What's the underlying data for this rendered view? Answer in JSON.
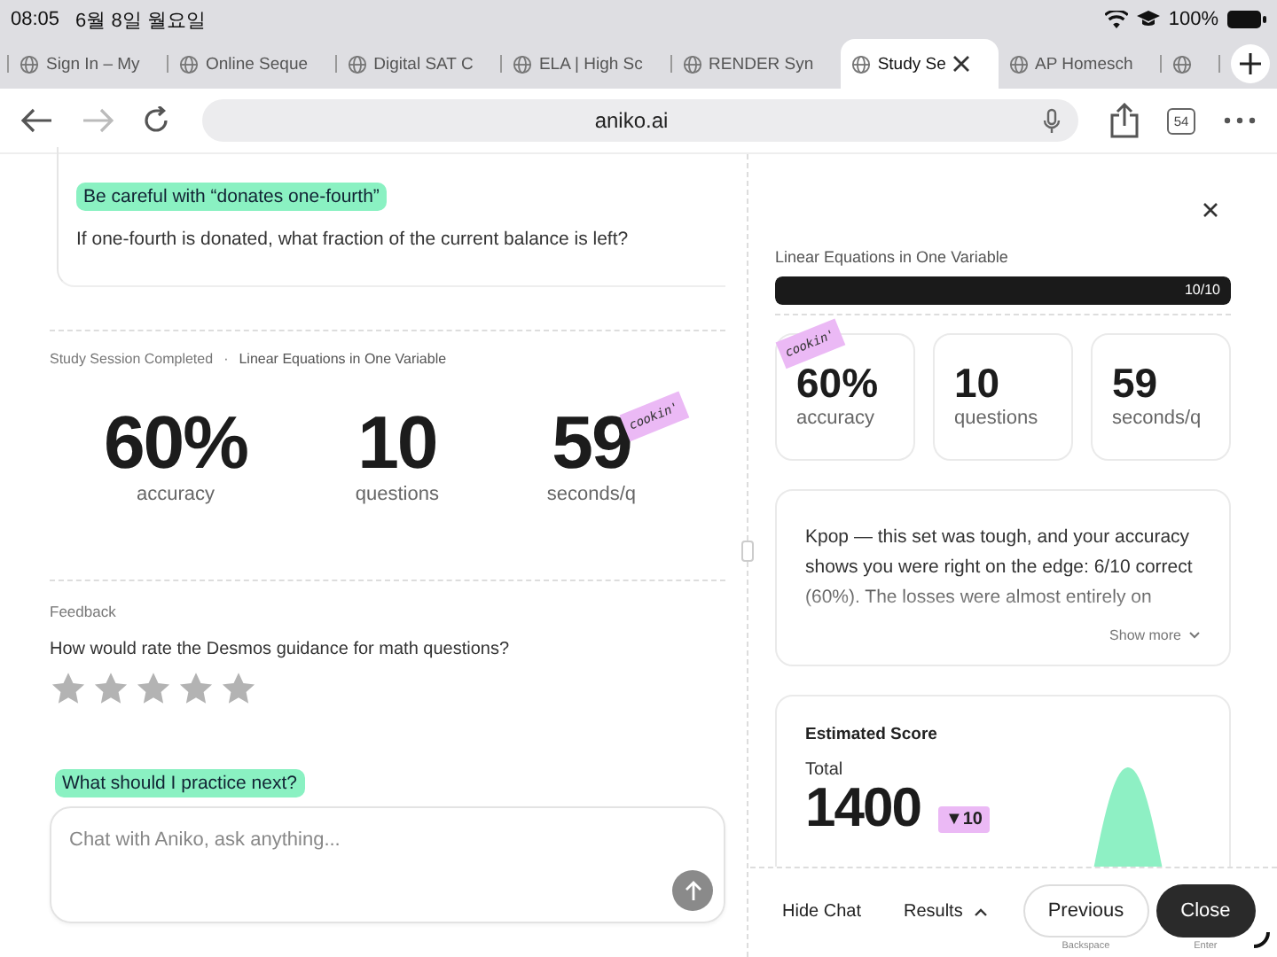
{
  "status_bar": {
    "time": "08:05",
    "date": "6월 8일 월요일",
    "battery": "100%"
  },
  "browser": {
    "tabs": [
      {
        "title": "Sign In – My",
        "selected": false
      },
      {
        "title": "Online Seque",
        "selected": false
      },
      {
        "title": "Digital SAT C",
        "selected": false
      },
      {
        "title": "ELA | High Sc",
        "selected": false
      },
      {
        "title": "RENDER Syn",
        "selected": false
      },
      {
        "title": "Study Se",
        "selected": true
      },
      {
        "title": "AP Homesch",
        "selected": false
      },
      {
        "selected": false
      }
    ],
    "url": "aniko.ai",
    "tab_count": "54"
  },
  "left": {
    "hint": {
      "label": "Be careful with “donates one-fourth”",
      "text": "If one-fourth is donated, what fraction of the current balance is left?"
    },
    "session": {
      "status": "Study Session Completed",
      "separator": "·",
      "topic": "Linear Equations in One Variable"
    },
    "stats": [
      {
        "value": "60%",
        "label": "accuracy"
      },
      {
        "value": "10",
        "label": "questions"
      },
      {
        "value": "59",
        "label": "seconds/q"
      }
    ],
    "sticker": "cookin'",
    "feedback": {
      "heading": "Feedback",
      "question": "How would rate the Desmos guidance for math questions?",
      "stars": 0
    },
    "suggestion": "What should I practice next?",
    "chat": {
      "placeholder": "Chat with Aniko, ask anything..."
    }
  },
  "right": {
    "title": "Linear Equations in One Variable",
    "progress": {
      "level": 1,
      "reading": "10/10"
    },
    "sticker": "cookin'",
    "stats": [
      {
        "value": "60%",
        "label": "accuracy"
      },
      {
        "value": "10",
        "label": "questions"
      },
      {
        "value": "59",
        "label": "seconds/q"
      }
    ],
    "summary": {
      "text": "Kpop — this set was tough, and your accuracy shows you were right on the edge: 6/10 correct (60%). The losses were almost entirely on",
      "more": "Show more"
    },
    "score": {
      "title": "Estimated Score",
      "label": "Total",
      "value": "1400",
      "change": "▼10"
    },
    "actions": [
      {
        "label": "Hide Chat",
        "kind": "text"
      },
      {
        "label": "Results",
        "kind": "menu"
      },
      {
        "label": "Previous",
        "kind": "outline",
        "hint": "Backspace"
      },
      {
        "label": "Close",
        "kind": "primary",
        "hint": "Enter"
      }
    ]
  }
}
